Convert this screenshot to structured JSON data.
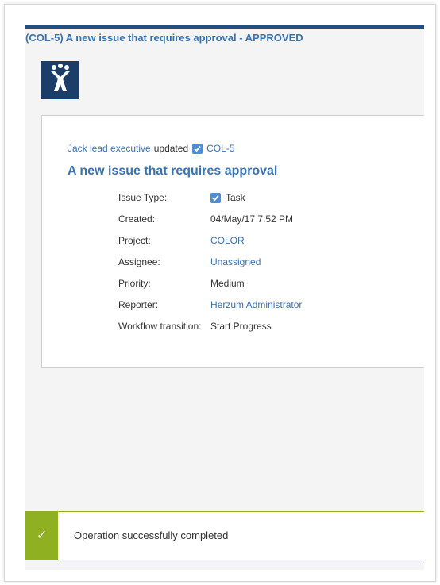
{
  "email": {
    "subject": "(COL-5) A new issue that requires approval - APPROVED",
    "logo_icon": "jira-logo-icon",
    "brand_color": "#205081",
    "update": {
      "actor": "Jack lead executive",
      "verb": "updated",
      "issue_key": "COL-5",
      "issue_type_icon": "checkbox-task-icon"
    },
    "issue_title": "A new issue that requires approval",
    "fields": [
      {
        "label": "Issue Type:",
        "value": "Task",
        "link": false,
        "icon": "checkbox-task-icon"
      },
      {
        "label": "Created:",
        "value": "04/May/17 7:52 PM",
        "link": false
      },
      {
        "label": "Project:",
        "value": "COLOR",
        "link": true
      },
      {
        "label": "Assignee:",
        "value": "Unassigned",
        "link": true
      },
      {
        "label": "Priority:",
        "value": "Medium",
        "link": false
      },
      {
        "label": "Reporter:",
        "value": "Herzum Administrator",
        "link": true
      },
      {
        "label": "Workflow transition:",
        "value": "Start Progress",
        "link": false
      }
    ]
  },
  "flag": {
    "icon": "checkmark-icon",
    "message": "Operation successfully completed",
    "color": "#8fb021"
  }
}
